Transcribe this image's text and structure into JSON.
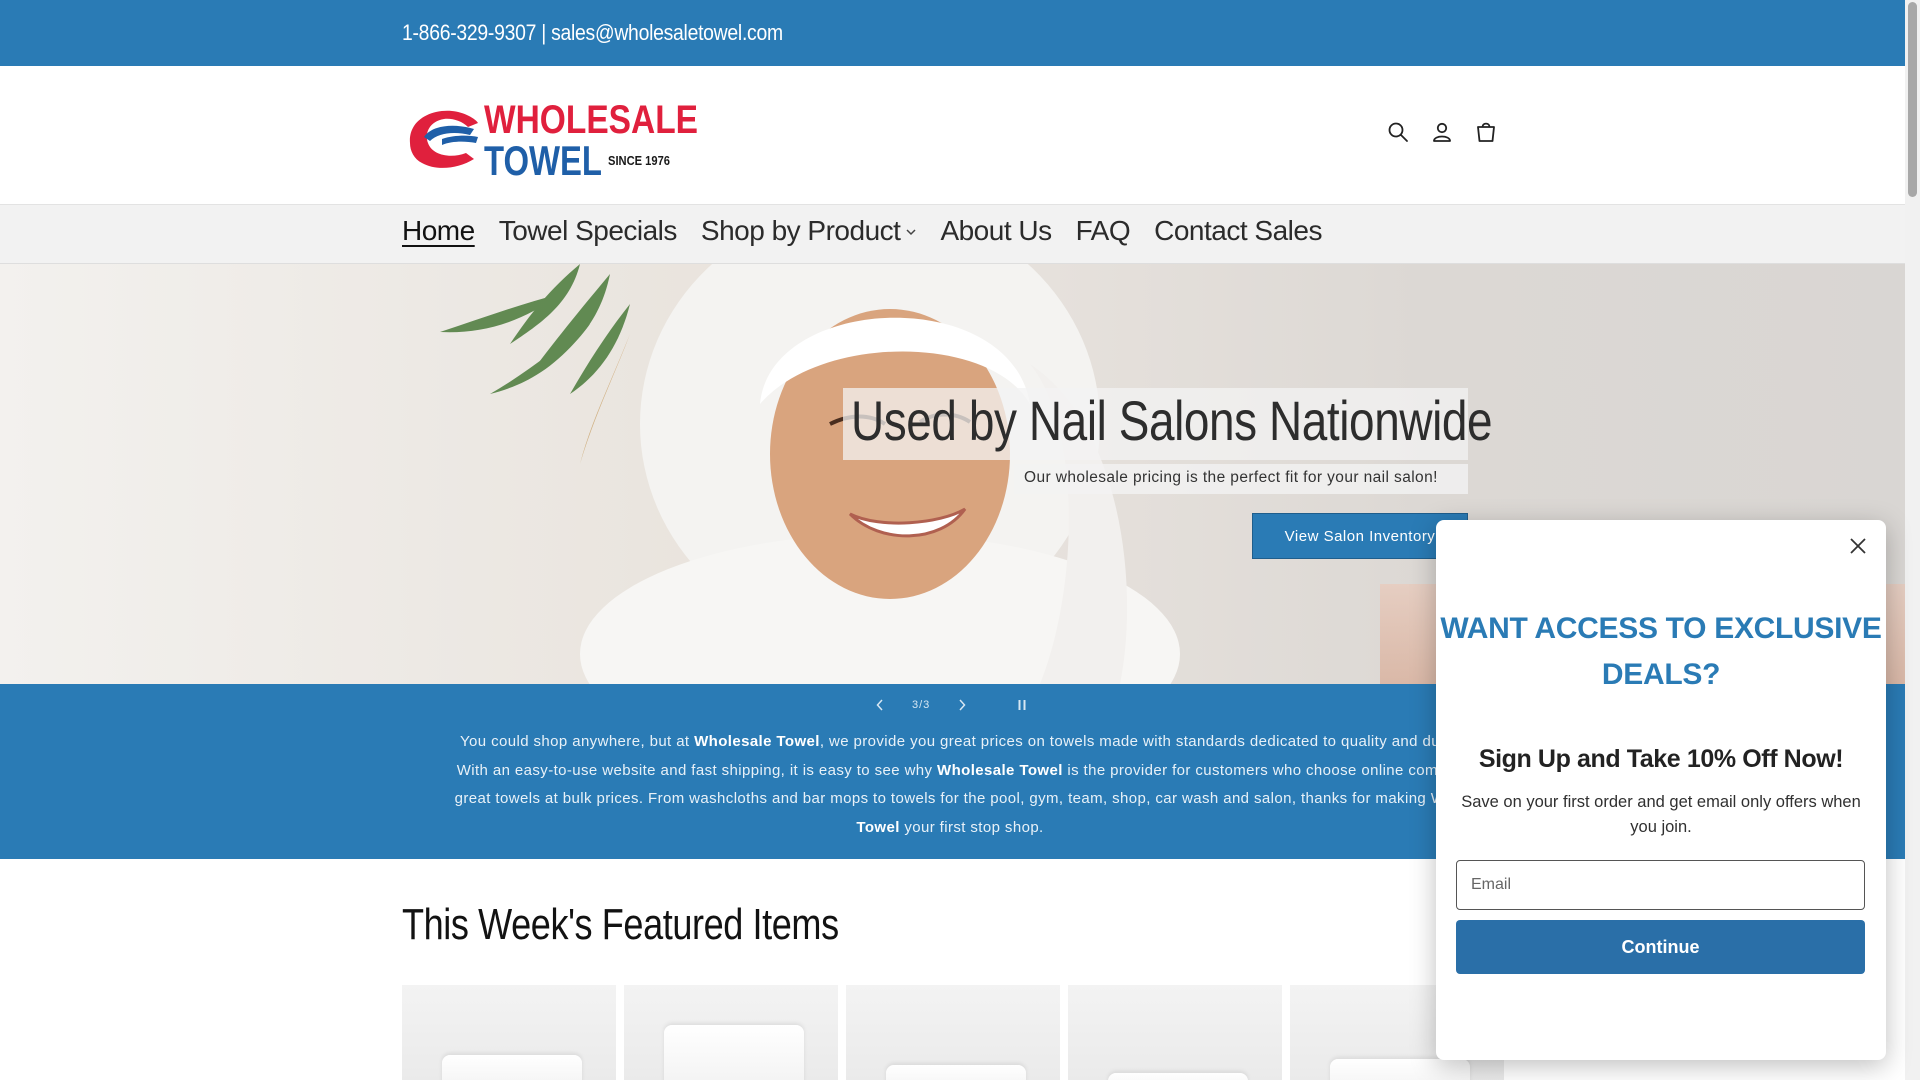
{
  "announcement": {
    "text": "1-866-329-9307 | sales@wholesaletowel.com"
  },
  "logo": {
    "line1": "WHOLESALE",
    "line2": "TOWEL",
    "since": "SINCE 1976",
    "colors": {
      "red": "#e0203d",
      "blue": "#1f5fa8"
    }
  },
  "header": {
    "icons": [
      "search-icon",
      "account-icon",
      "cart-icon"
    ]
  },
  "nav": {
    "items": [
      {
        "label": "Home",
        "active": true
      },
      {
        "label": "Towel Specials"
      },
      {
        "label": "Shop by Product",
        "dropdown": true
      },
      {
        "label": "About Us"
      },
      {
        "label": "FAQ"
      },
      {
        "label": "Contact Sales"
      }
    ]
  },
  "hero": {
    "title": "Used by Nail Salons Nationwide",
    "subtitle": "Our wholesale pricing is the perfect fit for your nail salon!",
    "button": "View Salon Inventory"
  },
  "slider": {
    "counter": "3/3"
  },
  "blurb": {
    "p1": "You could shop anywhere, but at ",
    "b1": "Wholesale Towel",
    "p2": ", we provide you great prices on towels made with standards dedicated to quality and du",
    "p3": "With an easy-to-use website and fast shipping, it is easy to see why ",
    "b2": "Wholesale Towel",
    "p4": " is the provider for customers who choose online comr",
    "p5": "great towels at bulk prices. From washcloths and bar mops to towels for the pool, gym, team, shop, car wash and salon, thanks for making W",
    "b3": "Towel",
    "p6": " your first stop shop."
  },
  "featured": {
    "title": "This Week's Featured Items",
    "product_count": 5
  },
  "popup": {
    "heading": "WANT ACCESS TO EXCLUSIVE DEALS?",
    "subheading": "Sign Up and Take 10% Off Now!",
    "text": "Save on your first order and get email only offers when you join.",
    "email_placeholder": "Email",
    "button": "Continue"
  },
  "colors": {
    "brand_blue": "#2a7bb5",
    "popup_blue": "#2a6fa8"
  }
}
